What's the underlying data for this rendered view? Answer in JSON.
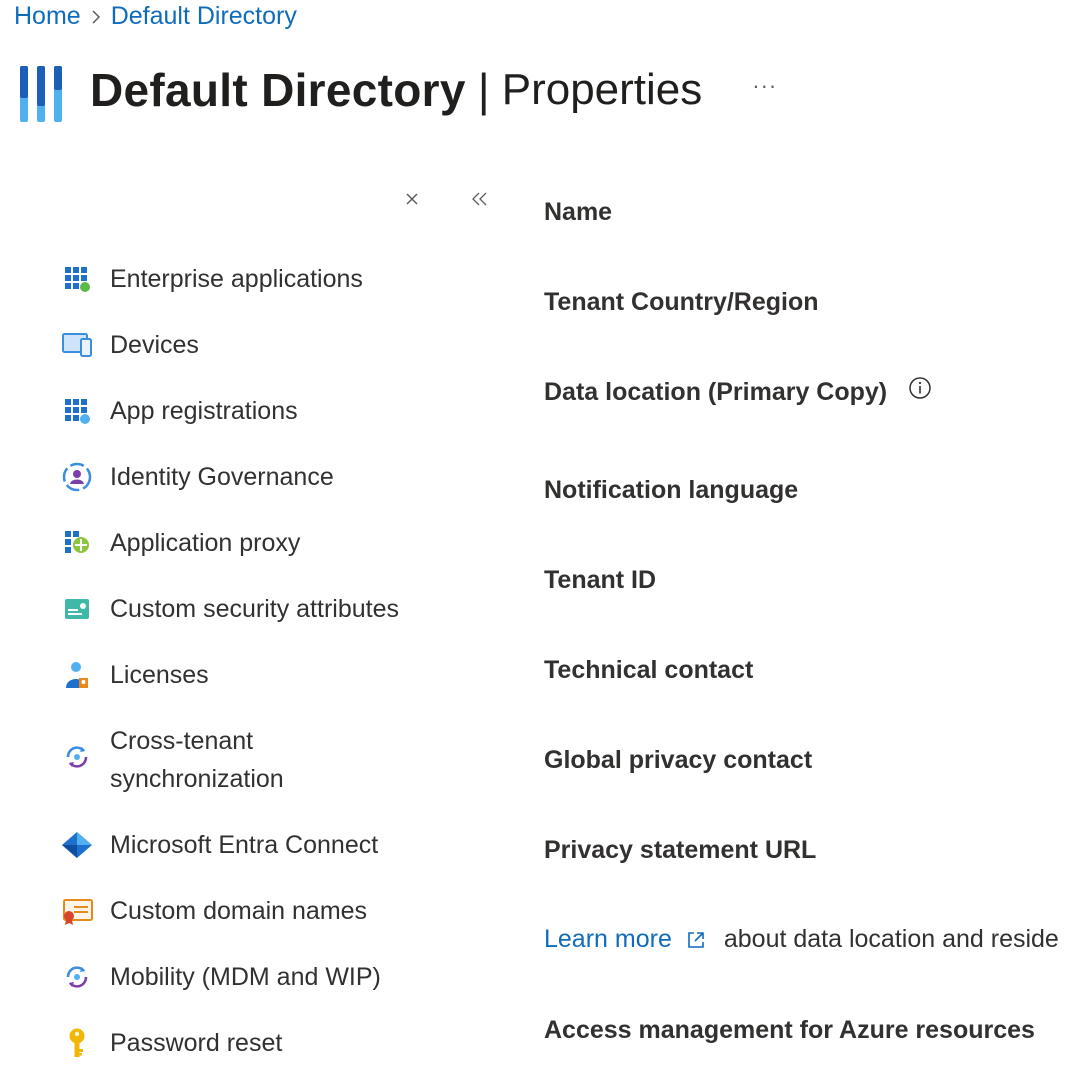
{
  "breadcrumb": {
    "home": "Home",
    "current": "Default Directory"
  },
  "header": {
    "title": "Default Directory",
    "separator": "|",
    "subtitle": "Properties",
    "more": "···"
  },
  "menu_controls": {
    "close_icon": "close-icon",
    "collapse_icon": "double-chevron-left-icon"
  },
  "sidebar": {
    "items": [
      {
        "label": "Enterprise applications",
        "icon": "enterprise-apps-icon"
      },
      {
        "label": "Devices",
        "icon": "devices-icon"
      },
      {
        "label": "App registrations",
        "icon": "app-registrations-icon"
      },
      {
        "label": "Identity Governance",
        "icon": "identity-governance-icon"
      },
      {
        "label": "Application proxy",
        "icon": "application-proxy-icon"
      },
      {
        "label": "Custom security attributes",
        "icon": "custom-security-attributes-icon"
      },
      {
        "label": "Licenses",
        "icon": "licenses-icon"
      },
      {
        "label": "Cross-tenant",
        "label2": "synchronization",
        "icon": "cross-tenant-sync-icon"
      },
      {
        "label": "Microsoft Entra Connect",
        "icon": "entra-connect-icon"
      },
      {
        "label": "Custom domain names",
        "icon": "custom-domain-icon"
      },
      {
        "label": "Mobility (MDM and WIP)",
        "icon": "mobility-icon"
      },
      {
        "label": "Password reset",
        "icon": "key-icon"
      }
    ]
  },
  "properties": {
    "name": "Name",
    "country": "Tenant Country/Region",
    "data_location": "Data location (Primary Copy)",
    "notification_language": "Notification language",
    "tenant_id": "Tenant ID",
    "technical_contact": "Technical contact",
    "global_privacy_contact": "Global privacy contact",
    "privacy_url": "Privacy statement URL",
    "learn_more": "Learn more",
    "learn_more_rest": "about data location and reside",
    "access_management": "Access management for Azure resources"
  },
  "colors": {
    "link": "#0f6cbd",
    "text": "#323130",
    "heading": "#201f1e",
    "accent_blue": "#0078d4"
  }
}
